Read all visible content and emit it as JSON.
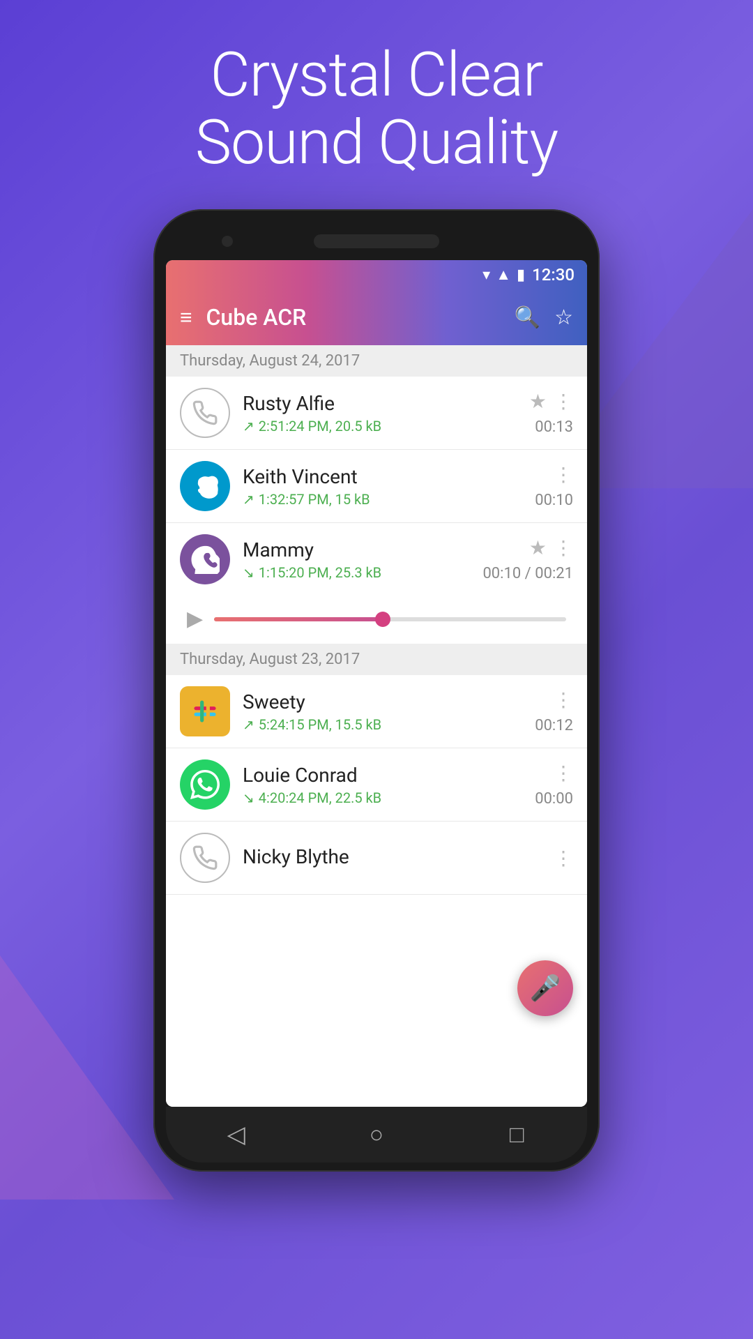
{
  "hero": {
    "line1": "Crystal Clear",
    "line2": "Sound Quality"
  },
  "status_bar": {
    "time": "12:30"
  },
  "app_bar": {
    "title": "Cube ACR",
    "menu_label": "Menu",
    "search_label": "Search",
    "star_label": "Favorites"
  },
  "groups": [
    {
      "date": "Thursday, August 24, 2017",
      "items": [
        {
          "id": "rusty-alfie",
          "name": "Rusty Alfie",
          "avatar_type": "phone",
          "direction": "up",
          "meta": "2:51:24 PM, 20.5 kB",
          "duration": "00:13",
          "starred": true,
          "has_more": true,
          "expanded": false
        },
        {
          "id": "keith-vincent",
          "name": "Keith Vincent",
          "avatar_type": "skype",
          "direction": "up",
          "meta": "1:32:57 PM, 15 kB",
          "duration": "00:10",
          "starred": false,
          "has_more": true,
          "expanded": false
        },
        {
          "id": "mammy",
          "name": "Mammy",
          "avatar_type": "viber",
          "direction": "down",
          "meta": "1:15:20 PM, 25.3 kB",
          "duration": "00:10 / 00:21",
          "starred": true,
          "has_more": true,
          "expanded": true,
          "progress": 48
        }
      ]
    },
    {
      "date": "Thursday, August 23, 2017",
      "items": [
        {
          "id": "sweety",
          "name": "Sweety",
          "avatar_type": "slack",
          "direction": "up",
          "meta": "5:24:15 PM, 15.5 kB",
          "duration": "00:12",
          "starred": false,
          "has_more": true,
          "expanded": false
        },
        {
          "id": "louie-conrad",
          "name": "Louie Conrad",
          "avatar_type": "whatsapp",
          "direction": "down",
          "meta": "4:20:24 PM, 22.5 kB",
          "duration": "00:00",
          "starred": false,
          "has_more": true,
          "expanded": false
        },
        {
          "id": "nicky-blythe",
          "name": "Nicky Blythe",
          "avatar_type": "phone",
          "direction": "up",
          "meta": "",
          "duration": "",
          "starred": false,
          "has_more": true,
          "expanded": false
        }
      ]
    }
  ],
  "nav": {
    "back": "◁",
    "home": "○",
    "recent": "□"
  }
}
